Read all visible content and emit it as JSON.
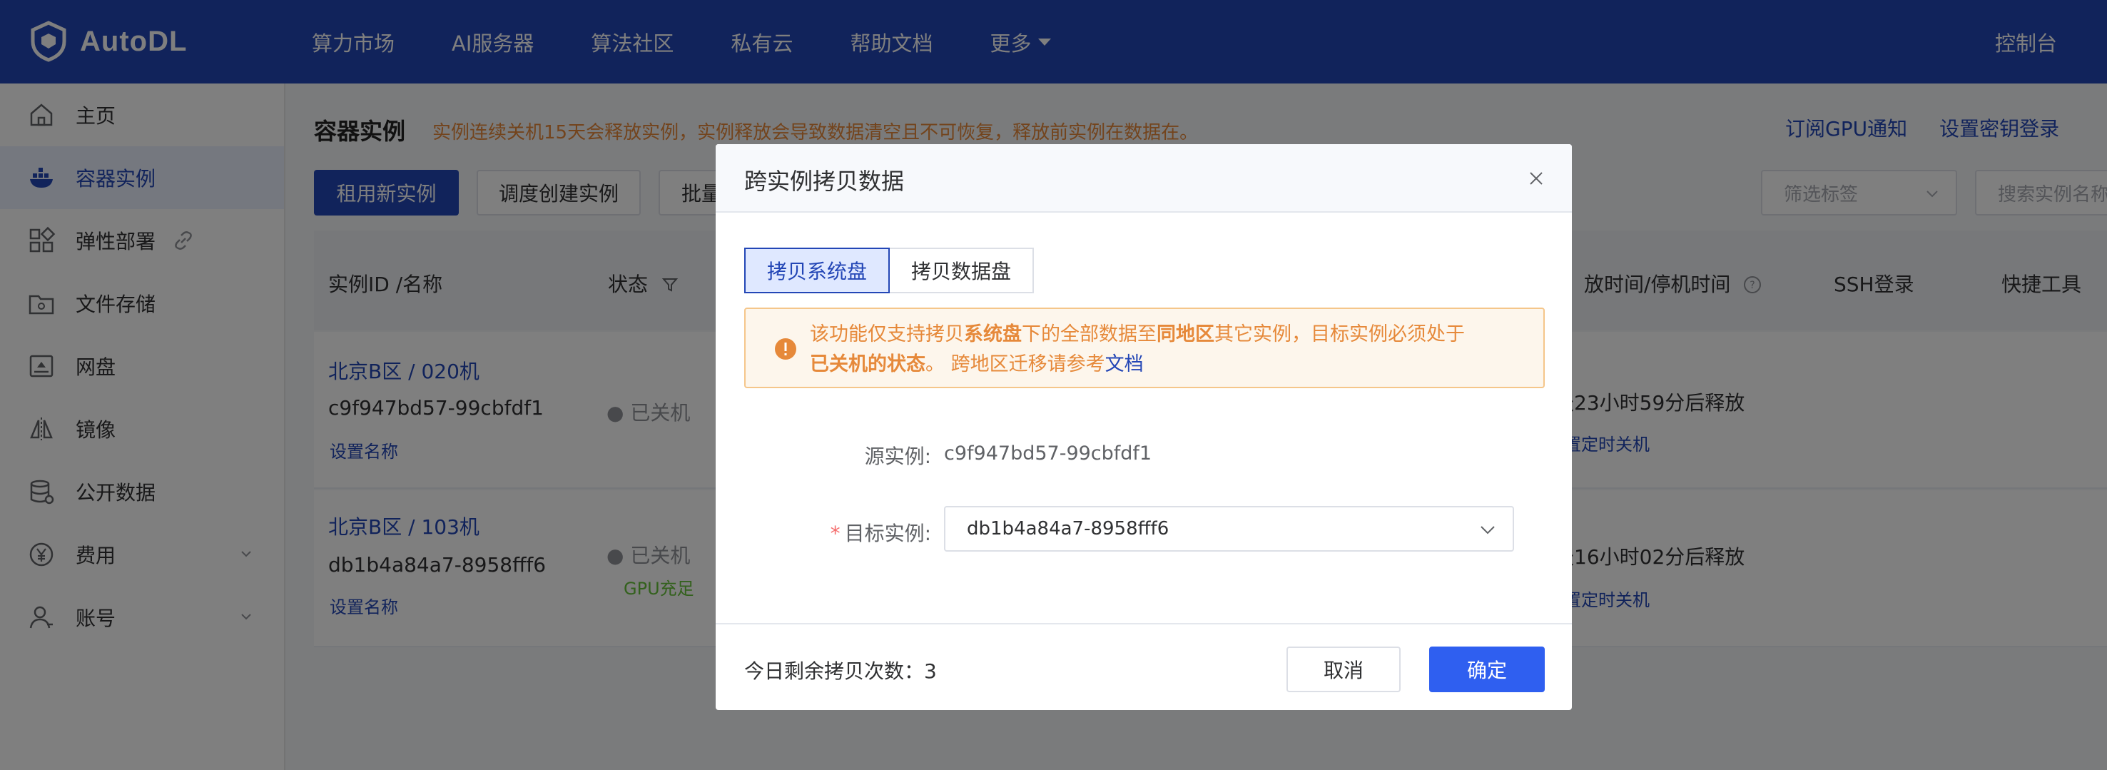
{
  "brand": {
    "name": "AutoDL"
  },
  "topnav": {
    "items": [
      "算力市场",
      "AI服务器",
      "算法社区",
      "私有云",
      "帮助文档"
    ],
    "more_label": "更多",
    "console_label": "控制台"
  },
  "sidebar": {
    "items": [
      {
        "label": "主页",
        "icon": "home-icon"
      },
      {
        "label": "容器实例",
        "icon": "container-icon"
      },
      {
        "label": "弹性部署",
        "icon": "grid-icon"
      },
      {
        "label": "文件存储",
        "icon": "folder-icon"
      },
      {
        "label": "网盘",
        "icon": "disk-icon"
      },
      {
        "label": "镜像",
        "icon": "mirror-icon"
      },
      {
        "label": "公开数据",
        "icon": "database-icon"
      },
      {
        "label": "费用",
        "icon": "yen-icon"
      },
      {
        "label": "账号",
        "icon": "user-icon"
      }
    ]
  },
  "page": {
    "title": "容器实例",
    "warning": "实例连续关机15天会释放实例，实例释放会导致数据清空且不可恢复，释放前实例在数据在。",
    "top_links": [
      "订阅GPU通知",
      "设置密钥登录"
    ],
    "buttons": {
      "rent_new": "租用新实例",
      "schedule_create": "调度创建实例",
      "batch": "批量"
    },
    "filter_placeholder": "筛选标签",
    "search_placeholder": "搜索实例名称"
  },
  "table": {
    "headers": {
      "id_name": "实例ID /名称",
      "status": "状态",
      "release_time": "放时间/停机时间",
      "ssh": "SSH登录",
      "tools": "快捷工具"
    },
    "rows": [
      {
        "region_machine": "北京B区 / 020机",
        "instance_id": "c9f947bd57-99cbfdf1",
        "set_name": "设置名称",
        "status": "已关机",
        "gpu_status": "",
        "release": "天23小时59分后释放",
        "timer": "置定时关机"
      },
      {
        "region_machine": "北京B区 / 103机",
        "instance_id": "db1b4a84a7-8958fff6",
        "set_name": "设置名称",
        "status": "已关机",
        "gpu_status": "GPU充足",
        "release": "天16小时02分后释放",
        "timer": "置定时关机"
      }
    ]
  },
  "modal": {
    "title": "跨实例拷贝数据",
    "tabs": [
      "拷贝系统盘",
      "拷贝数据盘"
    ],
    "active_tab": 0,
    "alert": {
      "p1": "该功能仅支持拷贝",
      "b1": "系统盘",
      "p2": "下的全部数据至",
      "b2": "同地区",
      "p3": "其它实例，目标实例必须处于",
      "b3": "已关机的状态",
      "p4": "。 跨地区迁移请参考",
      "link": "文档"
    },
    "source_label": "源实例:",
    "source_value": "c9f947bd57-99cbfdf1",
    "target_label": "目标实例:",
    "target_value": "db1b4a84a7-8958fff6",
    "remaining_label": "今日剩余拷贝次数：3",
    "cancel_label": "取消",
    "confirm_label": "确定"
  },
  "colors": {
    "brand_blue": "#2346b6",
    "primary_button": "#2f5ff0",
    "warning_text": "#e6893a",
    "warning_bg": "#fdf6ec",
    "success_green": "#67c23a"
  }
}
